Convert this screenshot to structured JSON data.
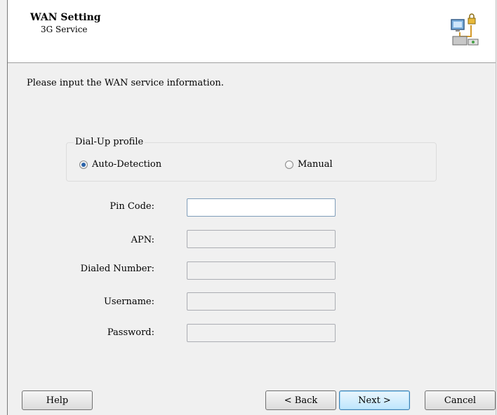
{
  "header": {
    "title": "WAN Setting",
    "subtitle": "3G Service",
    "icon": "network-setup-icon"
  },
  "instruction": "Please input the WAN service information.",
  "dialup_profile": {
    "legend": "Dial-Up profile",
    "options": [
      {
        "label": "Auto-Detection",
        "checked": true
      },
      {
        "label": "Manual",
        "checked": false
      }
    ]
  },
  "fields": [
    {
      "label": "Pin Code:",
      "value": "",
      "enabled": true
    },
    {
      "label": "APN:",
      "value": "",
      "enabled": false
    },
    {
      "label": "Dialed Number:",
      "value": "",
      "enabled": false
    },
    {
      "label": "Username:",
      "value": "",
      "enabled": false
    },
    {
      "label": "Password:",
      "value": "",
      "enabled": false
    }
  ],
  "buttons": {
    "help": "Help",
    "back": "< Back",
    "next": "Next >",
    "cancel": "Cancel"
  },
  "colors": {
    "accent": "#2a62a8",
    "default_button_border": "#3c7fb1"
  }
}
